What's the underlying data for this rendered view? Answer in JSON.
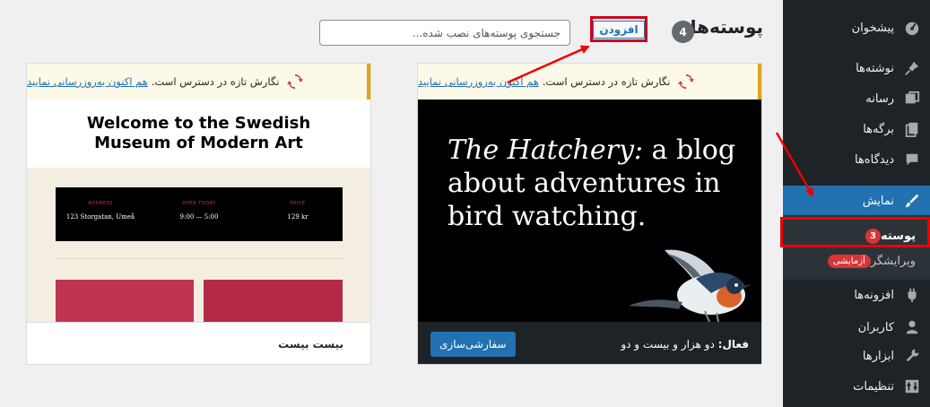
{
  "sidebar": {
    "items": [
      {
        "label": "پیشخوان",
        "icon": "dashboard-icon"
      },
      {
        "label": "نوشته‌ها",
        "icon": "pin-icon"
      },
      {
        "label": "رسانه",
        "icon": "media-icon"
      },
      {
        "label": "برگه‌ها",
        "icon": "pages-icon"
      },
      {
        "label": "دیدگاه‌ها",
        "icon": "comments-icon"
      },
      {
        "label": "نمایش",
        "icon": "brush-icon"
      },
      {
        "label": "افزونه‌ها",
        "icon": "plugins-icon"
      },
      {
        "label": "کاربران",
        "icon": "users-icon"
      },
      {
        "label": "ابزارها",
        "icon": "tools-icon"
      },
      {
        "label": "تنظیمات",
        "icon": "settings-icon"
      }
    ],
    "submenu": {
      "themes_label": "پوسته",
      "themes_badge": "3",
      "editor_label": "ویرایشگر",
      "editor_badge": "آزمایشی"
    },
    "active_color": "#2271b1"
  },
  "header": {
    "title": "پوسته‌ها",
    "count": "4",
    "add_label": "افزودن",
    "search_placeholder": "جستجوی پوسته‌های نصب شده..."
  },
  "themes": [
    {
      "notice_text": "نگارش تازه در دسترس است.",
      "notice_link": "هم اکنون به‌روزرسانی نمایید",
      "preview_title_italic": "The Hatchery:",
      "preview_title_rest": "a blog about adventures in bird watching.",
      "active_prefix": "فعال:",
      "active_name": "دو هزار و بیست و دو",
      "customize_label": "سفارشی‌سازی"
    },
    {
      "notice_text": "نگارش تازه در دسترس است.",
      "notice_link": "هم اکنون به‌روزرسانی نمایید",
      "preview_heading": "Welcome to the Swedish Museum of Modern Art",
      "info": [
        {
          "key": "ADDRESS",
          "value": "123 Storgatan, Umeå"
        },
        {
          "key": "OPEN TODAY",
          "value": "9:00 — 5:00"
        },
        {
          "key": "PRICE",
          "value": "129 kr"
        }
      ],
      "name": "بیست بیست"
    }
  ]
}
